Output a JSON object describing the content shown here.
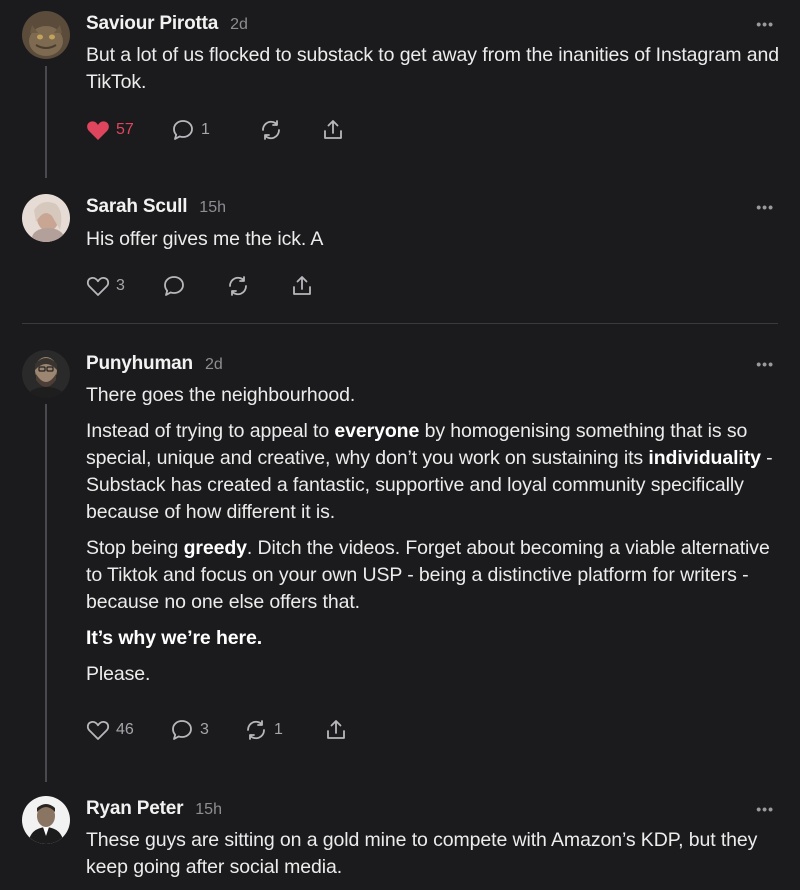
{
  "comments": [
    {
      "author": "Saviour Pirotta",
      "time": "2d",
      "more": "•••",
      "paragraphs": [
        "But a lot of us flocked to substack to get away from the inanities of Instagram and TikTok."
      ],
      "likes": "57",
      "replies": "1",
      "restacks": "",
      "liked": true,
      "avatar_colors": [
        "#6b5a44",
        "#8c7a5c"
      ]
    },
    {
      "author": "Sarah Scull",
      "time": "15h",
      "more": "•••",
      "paragraphs": [
        "His offer gives me the ick. A"
      ],
      "likes": "3",
      "replies": "",
      "restacks": "",
      "liked": false,
      "avatar_colors": [
        "#cdb8b0",
        "#e8dcd6"
      ]
    },
    {
      "author": "Punyhuman",
      "time": "2d",
      "more": "•••",
      "p1": "There goes the neighbourhood.",
      "p2a": "Instead of trying to appeal to ",
      "p2b": "everyone",
      "p2c": " by homogenising something that is so special, unique and creative, why don’t you work on sustaining its ",
      "p2d": "individuality",
      "p2e": " - Substack has created a fantastic, supportive and loyal community specifically because of how different it is.",
      "p3a": "Stop being ",
      "p3b": "greedy",
      "p3c": ". Ditch the videos. Forget about becoming a viable alternative to Tiktok and focus on your own USP - being a distinctive platform for writers - because no one else offers that.",
      "p4": "It’s why we’re here.",
      "p5": "Please.",
      "likes": "46",
      "replies": "3",
      "restacks": "1",
      "liked": false
    },
    {
      "author": "Ryan Peter",
      "time": "15h",
      "more": "•••",
      "paragraphs": [
        "These guys are sitting on a gold mine to compete with Amazon’s KDP, but they keep going after social media."
      ]
    }
  ],
  "colors": {
    "like_active": "#e0455e",
    "background": "#1b1b1d",
    "text": "#ececec",
    "muted": "#8e8e92"
  },
  "icons": [
    "heart-icon",
    "comment-icon",
    "restack-icon",
    "share-icon",
    "more-icon"
  ]
}
